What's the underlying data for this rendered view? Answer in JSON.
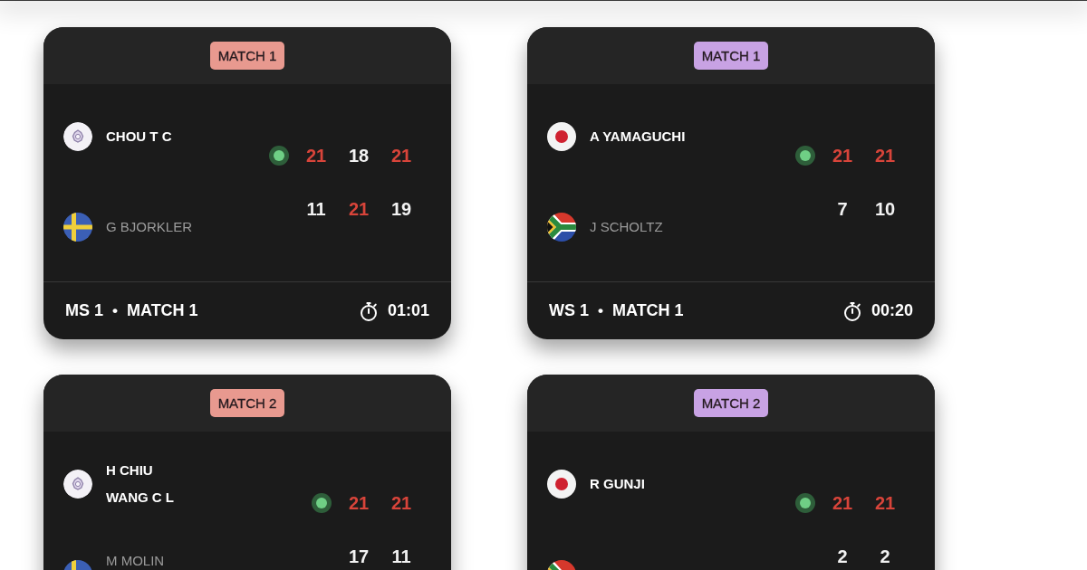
{
  "matches": [
    {
      "badge": "MATCH 1",
      "color": "#e8998f",
      "kind": "singles",
      "teams": [
        {
          "kind": "taipei",
          "names": [
            "CHOU T C"
          ],
          "winner": true,
          "serving": true,
          "scores": [
            {
              "value": "21",
              "won": true
            },
            {
              "value": "18",
              "won": false
            },
            {
              "value": "21",
              "won": true
            }
          ]
        },
        {
          "kind": "sweden",
          "names": [
            "G BJORKLER"
          ],
          "winner": false,
          "serving": false,
          "scores": [
            {
              "value": "11",
              "won": false
            },
            {
              "value": "21",
              "won": true
            },
            {
              "value": "19",
              "won": false
            }
          ]
        }
      ],
      "footer": {
        "event": "MS 1",
        "separator": "•",
        "match": "MATCH 1",
        "duration": "01:01"
      }
    },
    {
      "badge": "MATCH 1",
      "color": "#c8a2e4",
      "kind": "singles",
      "teams": [
        {
          "kind": "japan",
          "names": [
            "A YAMAGUCHI"
          ],
          "winner": true,
          "serving": true,
          "scores": [
            {
              "value": "21",
              "won": true
            },
            {
              "value": "21",
              "won": true
            }
          ]
        },
        {
          "kind": "southafrica",
          "names": [
            "J SCHOLTZ"
          ],
          "winner": false,
          "serving": false,
          "scores": [
            {
              "value": "7",
              "won": false
            },
            {
              "value": "10",
              "won": false
            }
          ]
        }
      ],
      "footer": {
        "event": "WS 1",
        "separator": "•",
        "match": "MATCH 1",
        "duration": "00:20"
      }
    },
    {
      "badge": "MATCH 2",
      "color": "#e8998f",
      "kind": "doubles",
      "teams": [
        {
          "kind": "taipei",
          "names": [
            "H CHIU",
            "WANG C L"
          ],
          "winner": true,
          "serving": true,
          "scores": [
            {
              "value": "21",
              "won": true
            },
            {
              "value": "21",
              "won": true
            }
          ]
        },
        {
          "kind": "sweden",
          "names": [
            "M MOLIN"
          ],
          "winner": false,
          "serving": false,
          "scores": [
            {
              "value": "17",
              "won": false
            },
            {
              "value": "11",
              "won": false
            }
          ]
        }
      ]
    },
    {
      "badge": "MATCH 2",
      "color": "#c8a2e4",
      "kind": "singles",
      "teams": [
        {
          "kind": "japan",
          "names": [
            "R GUNJI"
          ],
          "winner": true,
          "serving": true,
          "scores": [
            {
              "value": "21",
              "won": true
            },
            {
              "value": "21",
              "won": true
            }
          ]
        },
        {
          "kind": "southafrica",
          "serving": false,
          "scores": [
            {
              "value": "2",
              "won": false
            },
            {
              "value": "2",
              "won": false
            }
          ]
        }
      ]
    }
  ]
}
